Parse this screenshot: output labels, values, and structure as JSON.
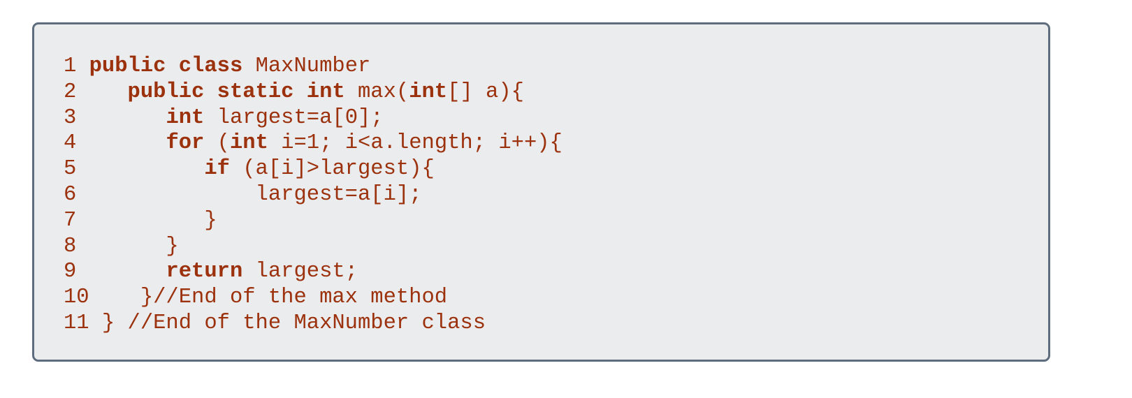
{
  "code_block": {
    "text_color": "#9c320d",
    "background": "#ebecee",
    "border_color": "#5e6d7e",
    "lines": [
      {
        "number": "1",
        "segments": [
          {
            "t": " "
          },
          {
            "t": "public class",
            "kw": true
          },
          {
            "t": " MaxNumber"
          }
        ]
      },
      {
        "number": "2",
        "segments": [
          {
            "t": "    "
          },
          {
            "t": "public static int",
            "kw": true
          },
          {
            "t": " max("
          },
          {
            "t": "int",
            "kw": true
          },
          {
            "t": "[] a){"
          }
        ]
      },
      {
        "number": "3",
        "segments": [
          {
            "t": "       "
          },
          {
            "t": "int",
            "kw": true
          },
          {
            "t": " largest=a[0];"
          }
        ]
      },
      {
        "number": "4",
        "segments": [
          {
            "t": "       "
          },
          {
            "t": "for",
            "kw": true
          },
          {
            "t": " ("
          },
          {
            "t": "int",
            "kw": true
          },
          {
            "t": " i=1; i<a.length; i++){"
          }
        ]
      },
      {
        "number": "5",
        "segments": [
          {
            "t": "          "
          },
          {
            "t": "if",
            "kw": true
          },
          {
            "t": " (a[i]>largest){"
          }
        ]
      },
      {
        "number": "6",
        "segments": [
          {
            "t": "              largest=a[i];"
          }
        ]
      },
      {
        "number": "7",
        "segments": [
          {
            "t": "          }"
          }
        ]
      },
      {
        "number": "8",
        "segments": [
          {
            "t": "       }"
          }
        ]
      },
      {
        "number": "9",
        "segments": [
          {
            "t": "       "
          },
          {
            "t": "return",
            "kw": true
          },
          {
            "t": " largest;"
          }
        ]
      },
      {
        "number": "10",
        "segments": [
          {
            "t": "    }//End of the max method"
          }
        ]
      },
      {
        "number": "11",
        "segments": [
          {
            "t": " } //End of the MaxNumber class"
          }
        ]
      }
    ]
  }
}
